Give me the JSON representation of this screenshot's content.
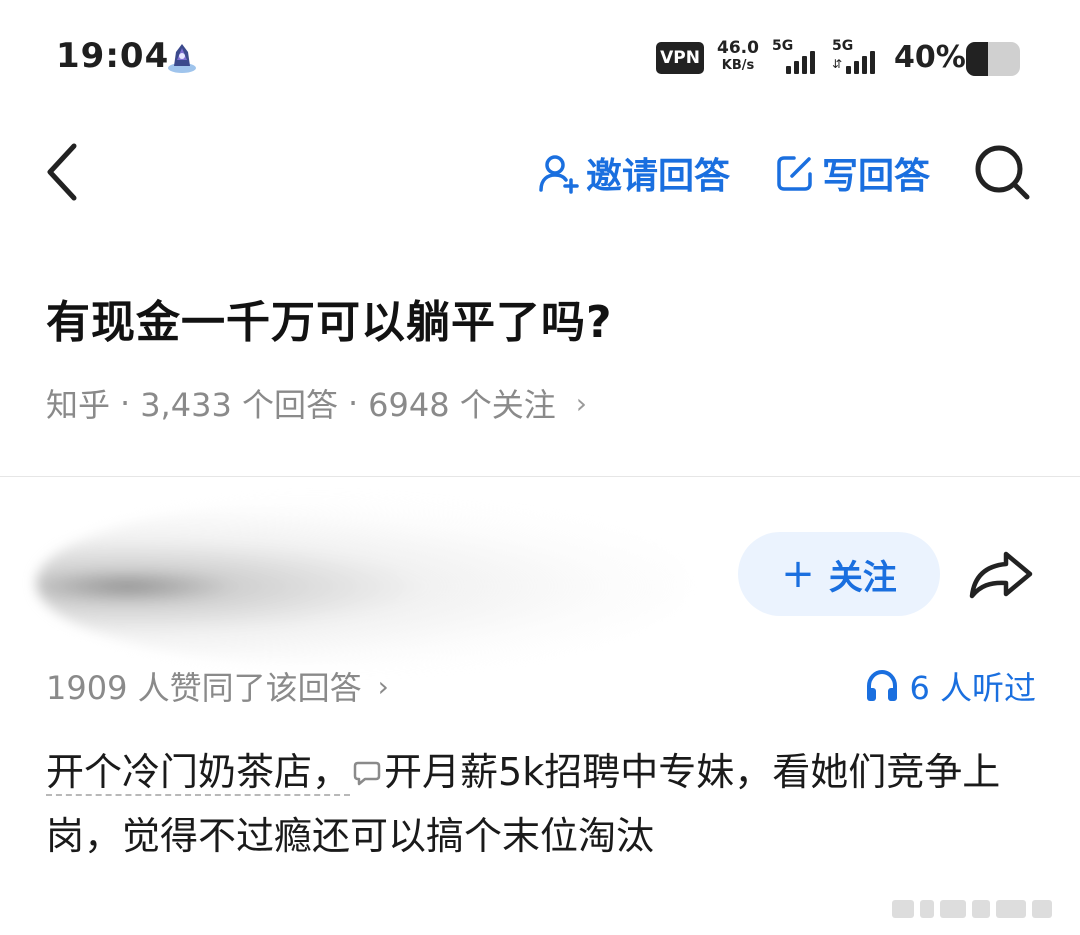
{
  "status_bar": {
    "time": "19:04",
    "vpn": "VPN",
    "net_speed_value": "46.0",
    "net_speed_unit": "KB/s",
    "sim1_tag": "5G",
    "sim2_tag": "5G",
    "battery_percent": "40%",
    "battery_level": 0.4,
    "icons": [
      "app-icon",
      "signal-icon",
      "battery-icon"
    ]
  },
  "nav": {
    "invite_label": "邀请回答",
    "write_label": "写回答",
    "accent_color": "#1a6fdf",
    "icons": [
      "back-arrow-icon",
      "invite-user-icon",
      "edit-icon",
      "search-icon"
    ]
  },
  "question": {
    "title": "有现金一千万可以躺平了吗?",
    "source": "知乎",
    "answers_count": "3,433 个回答",
    "followers_count": "6948 个关注",
    "separator": "·",
    "chevron": "›"
  },
  "author": {
    "follow_label": "关注",
    "follow_plus": "+"
  },
  "answer": {
    "upvote_text": "1909 人赞同了该回答",
    "listened_text": "6 人听过",
    "content_part1": "开个冷门奶茶店，",
    "content_part2": "开月薪5k招聘中专妹，看她们竞争上岗，觉得不过瘾还可以搞个末位淘汰"
  }
}
